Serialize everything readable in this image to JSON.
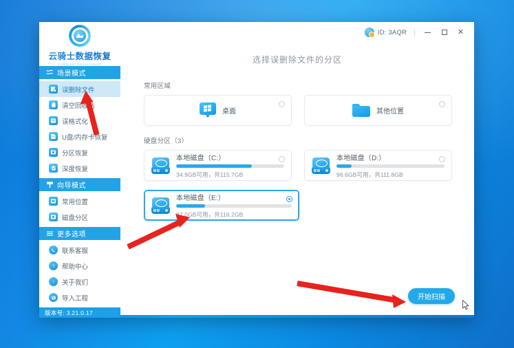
{
  "window": {
    "brand_name": "云骑士数据恢复",
    "brand_sub": "YUNQISHI SHUJU HUIFU",
    "account_id": "ID: 3AQR",
    "minimize_label": "—",
    "maximize_label": "□",
    "close_label": "✕",
    "version": "版本号: 3.21.0.17"
  },
  "sidebar": {
    "sections": [
      {
        "header": "场景模式",
        "header_icon": "scene-icon",
        "items": [
          {
            "label": "误删除文件",
            "icon": "deleted-file-icon",
            "active": true
          },
          {
            "label": "清空回收站",
            "icon": "recycle-bin-icon",
            "active": false
          },
          {
            "label": "误格式化",
            "icon": "format-icon",
            "active": false
          },
          {
            "label": "U盘/内存卡恢复",
            "icon": "usb-card-icon",
            "active": false
          },
          {
            "label": "分区恢复",
            "icon": "partition-icon",
            "active": false
          },
          {
            "label": "深度恢复",
            "icon": "deep-scan-icon",
            "active": false
          }
        ]
      },
      {
        "header": "向导模式",
        "header_icon": "wizard-icon",
        "items": [
          {
            "label": "常用位置",
            "icon": "common-location-icon",
            "active": false
          },
          {
            "label": "磁盘分区",
            "icon": "disk-partition-icon",
            "active": false
          }
        ]
      },
      {
        "header": "更多选项",
        "header_icon": "menu-icon",
        "items": [
          {
            "label": "联系客服",
            "icon": "phone-icon",
            "active": false
          },
          {
            "label": "帮助中心",
            "icon": "question-icon",
            "active": false
          },
          {
            "label": "关于我们",
            "icon": "info-icon",
            "active": false
          },
          {
            "label": "导入工程",
            "icon": "import-icon",
            "active": false
          }
        ]
      }
    ]
  },
  "main": {
    "page_title": "选择误删除文件的分区",
    "quick_group_label": "常用区域",
    "quick_areas": [
      {
        "label": "桌面",
        "icon": "desktop-icon",
        "selected": false
      },
      {
        "label": "其他位置",
        "icon": "folder-icon",
        "selected": false
      }
    ],
    "disk_group_label": "硬盘分区（3）",
    "disks": [
      {
        "name": "本地磁盘（C:）",
        "meta": "34.9GB可用，共115.7GB",
        "used_percent": 70,
        "selected": false
      },
      {
        "name": "本地磁盘（D:）",
        "meta": "96.6GB可用，共111.8GB",
        "used_percent": 14,
        "selected": false
      },
      {
        "name": "本地磁盘（E:）",
        "meta": "87.0GB可用，共116.2GB",
        "used_percent": 25,
        "selected": true
      }
    ],
    "scan_button": "开始扫描"
  },
  "colors": {
    "accent": "#22a9e9",
    "sidebar_header": "#22a3e8",
    "active_item": "#cfe8f8",
    "bar_fill": "#2aa8ef",
    "annotation": "#e8221c"
  }
}
